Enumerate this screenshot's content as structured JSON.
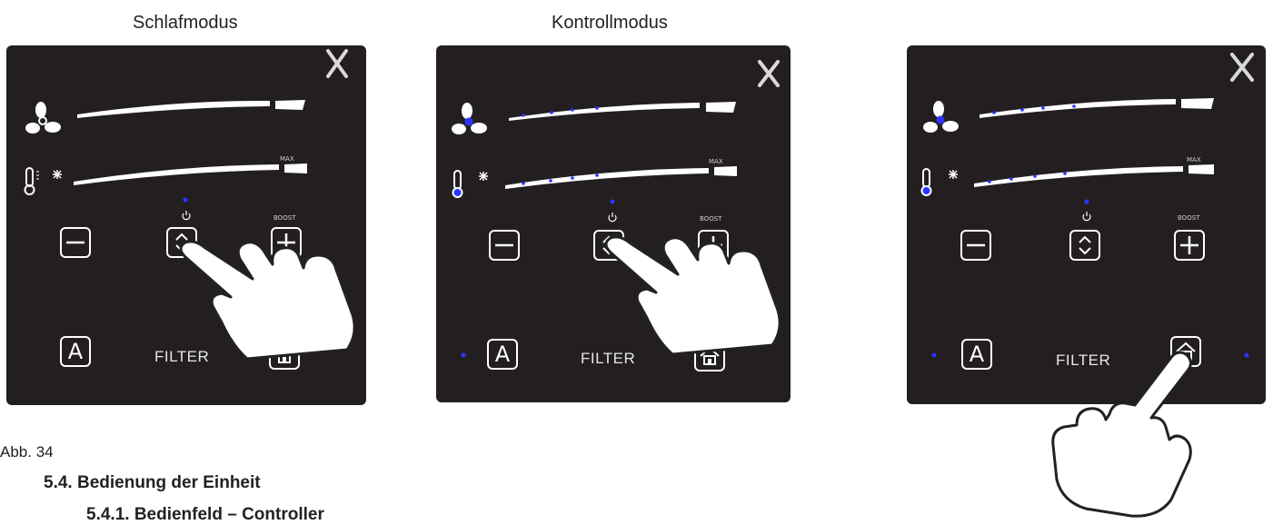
{
  "figure": {
    "captions": [
      "Schlafmodus",
      "Kontrollmodus"
    ],
    "figure_label": "Abb. 34"
  },
  "panel": {
    "filter_label": "FILTER",
    "max_label": "MAX",
    "boost_label": "BOOST",
    "auto_label": "A"
  },
  "sections": {
    "heading": "5.4.  Bedienung der Einheit",
    "subheading": "5.4.1.    Bedienfeld – Controller"
  },
  "colors": {
    "panel_bg": "#231f20",
    "indicator": "#2a35ff",
    "foreground": "#ffffff"
  },
  "icons": [
    "close-icon",
    "fan-icon",
    "thermometer-icon",
    "snowflake-icon",
    "power-icon",
    "minus-icon",
    "up-down-icon",
    "plus-icon",
    "house-thermometer-icon",
    "hand-pointer-icon"
  ]
}
